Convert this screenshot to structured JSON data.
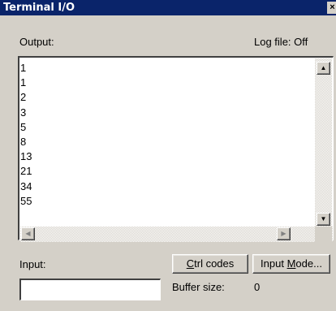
{
  "window": {
    "title": "Terminal I/O",
    "close_glyph": "×"
  },
  "output": {
    "label": "Output:",
    "log_file": "Log file:  Off",
    "lines": [
      "1",
      "1",
      "2",
      "3",
      "5",
      "8",
      "13",
      "21",
      "34",
      "55"
    ]
  },
  "scroll": {
    "up_glyph": "▲",
    "down_glyph": "▼",
    "left_glyph": "◀",
    "right_glyph": "▶"
  },
  "input": {
    "label": "Input:",
    "value": ""
  },
  "buttons": {
    "ctrl_codes": {
      "mnemonic": "C",
      "rest": "trl codes"
    },
    "input_mode": {
      "prefix": "Input ",
      "mnemonic": "M",
      "rest": "ode..."
    }
  },
  "buffer": {
    "label": "Buffer size:",
    "value": "0"
  }
}
